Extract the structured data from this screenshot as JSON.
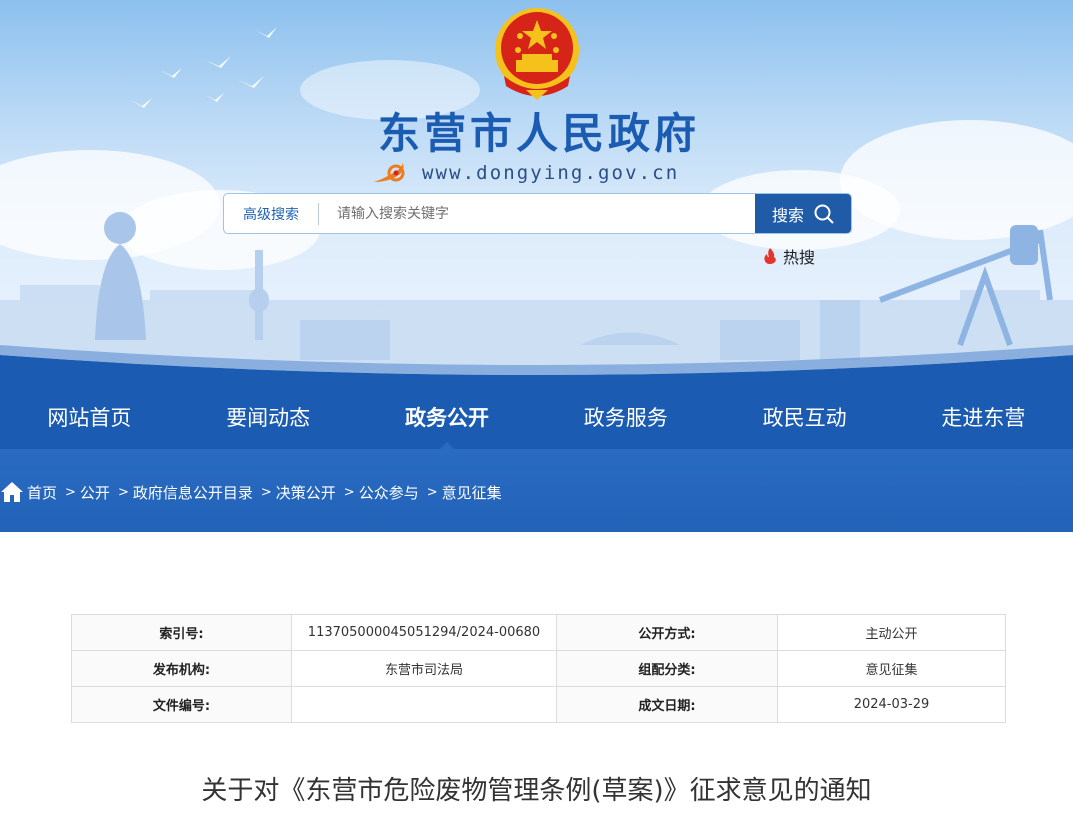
{
  "header": {
    "site_title": "东营市人民政府",
    "site_url": "www.dongying.gov.cn",
    "emblem_icon": "national-emblem-icon",
    "url_logo_icon": "orange-swirl-logo-icon"
  },
  "search": {
    "advanced_label": "高级搜索",
    "placeholder": "请输入搜索关键字",
    "button_label": "搜索",
    "hot_label": "热搜"
  },
  "nav": {
    "items": [
      {
        "label": "网站首页",
        "active": false
      },
      {
        "label": "要闻动态",
        "active": false
      },
      {
        "label": "政务公开",
        "active": true
      },
      {
        "label": "政务服务",
        "active": false
      },
      {
        "label": "政民互动",
        "active": false
      },
      {
        "label": "走进东营",
        "active": false
      }
    ]
  },
  "breadcrumb": {
    "items": [
      "首页",
      "公开",
      "政府信息公开目录",
      "决策公开",
      "公众参与",
      "意见征集"
    ],
    "separator": ">"
  },
  "meta": {
    "index_label": "索引号:",
    "index_value": "113705000045051294/2024-00680",
    "open_label": "公开方式:",
    "open_value": "主动公开",
    "publisher_label": "发布机构:",
    "publisher_value": "东营市司法局",
    "category_label": "组配分类:",
    "category_value": "意见征集",
    "doc_no_label": "文件编号:",
    "doc_no_value": "",
    "date_label": "成文日期:",
    "date_value": "2024-03-29"
  },
  "article": {
    "title": "关于对《东营市危险废物管理条例(草案)》征求意见的通知"
  },
  "colors": {
    "brand_blue": "#1b5cb2",
    "breadcrumb_blue": "#2a6bc2",
    "emblem_red": "#d62418",
    "emblem_gold": "#f5c21b"
  }
}
